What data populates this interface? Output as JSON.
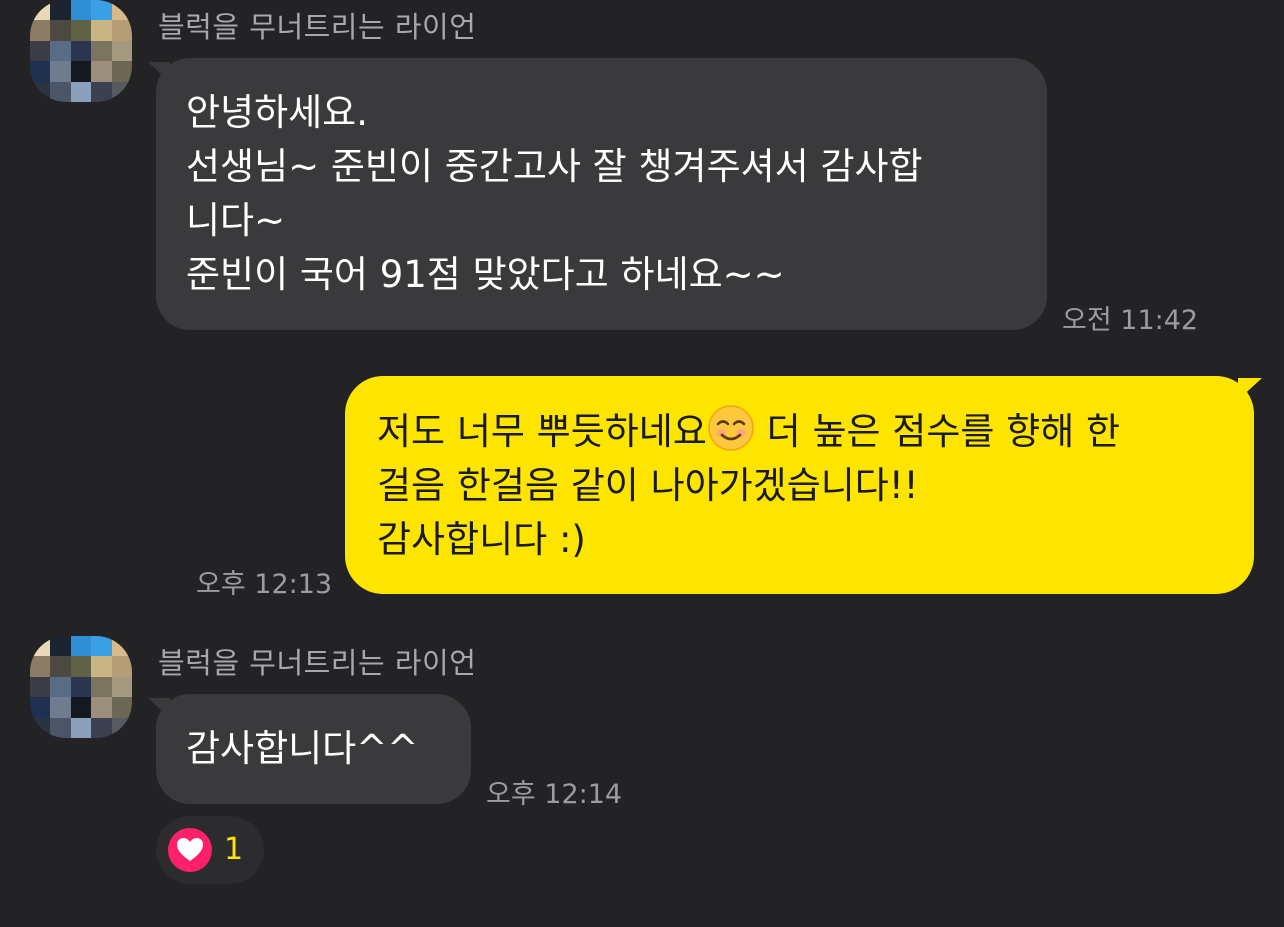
{
  "messages": [
    {
      "sender": "블럭을 무너트리는 라이언",
      "direction": "incoming",
      "lines": [
        "안녕하세요.",
        "선생님~ 준빈이 중간고사 잘 챙겨주셔서 감사합",
        "니다~",
        "준빈이 국어 91점 맞았다고 하네요~~"
      ],
      "time": "오전 11:42"
    },
    {
      "direction": "outgoing",
      "lines": [
        {
          "before": "저도 너무 뿌듯하네요",
          "emoji": "smiling-face-emoji",
          "after": " 더 높은 점수를 향해 한"
        },
        "걸음 한걸음 같이 나아가겠습니다!!",
        "감사합니다 :)"
      ],
      "time": "오후 12:13"
    },
    {
      "sender": "블럭을 무너트리는 라이언",
      "direction": "incoming",
      "lines": [
        "감사합니다^^"
      ],
      "time": "오후 12:14",
      "reaction": {
        "icon": "heart-icon",
        "count": "1"
      }
    }
  ],
  "colors": {
    "background": "#232325",
    "incoming_bubble": "#3a3a3d",
    "outgoing_bubble": "#fee500",
    "reaction_heart": "#ff1f6b",
    "reaction_count": "#fee500"
  },
  "avatar": {
    "style": "pixelated-profile-photo",
    "pixels": [
      [
        "#e9d9b8",
        "#1b2430",
        "#2f8fd6",
        "#3aa0e6",
        "#d7b98c"
      ],
      [
        "#8c7c66",
        "#4c4842",
        "#5f6244",
        "#c9b483",
        "#b59d76"
      ],
      [
        "#3a3d45",
        "#5a6b86",
        "#2b3550",
        "#7b7460",
        "#a59a7f"
      ],
      [
        "#1f3150",
        "#6f7c8f",
        "#141820",
        "#9b8f7b",
        "#6c6654"
      ],
      [
        "#2a3340",
        "#4a5568",
        "#8aa0bb",
        "#3b4150",
        "#575a60"
      ]
    ]
  }
}
